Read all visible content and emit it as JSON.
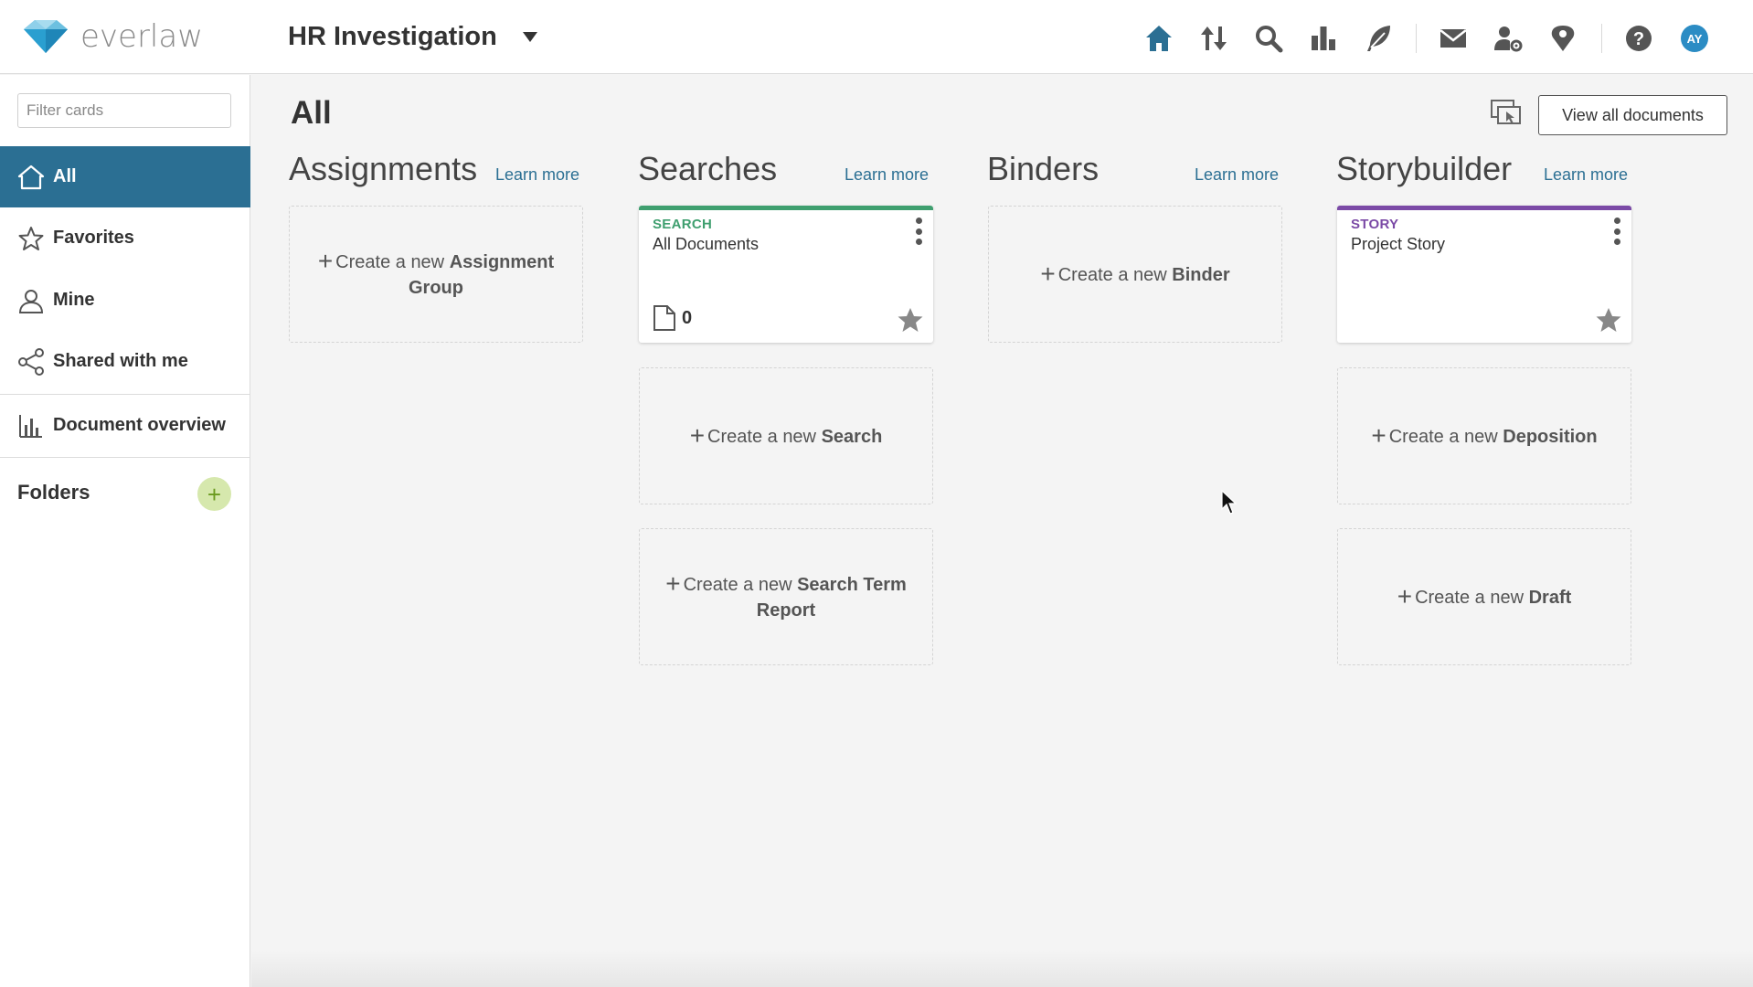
{
  "app": {
    "logo_text": "everlaw",
    "project_name": "HR Investigation"
  },
  "nav_icons": [
    "home-icon",
    "upload-download-icon",
    "search-icon",
    "analytics-icon",
    "feather-icon",
    "mail-icon",
    "user-settings-icon",
    "map-pin-icon",
    "help-icon",
    "avatar"
  ],
  "user": {
    "initials": "AY"
  },
  "sidebar": {
    "filter_placeholder": "Filter cards",
    "items": [
      {
        "label": "All",
        "icon": "home-icon",
        "active": true
      },
      {
        "label": "Favorites",
        "icon": "star-outline-icon"
      },
      {
        "label": "Mine",
        "icon": "person-icon"
      },
      {
        "label": "Shared with me",
        "icon": "share-icon"
      },
      {
        "label": "Document overview",
        "icon": "bar-chart-icon"
      }
    ],
    "folders_label": "Folders",
    "folders_add": "+"
  },
  "main": {
    "title": "All",
    "view_all_label": "View all documents",
    "columns": [
      {
        "title": "Assignments",
        "learn_more": "Learn more"
      },
      {
        "title": "Searches",
        "learn_more": "Learn more"
      },
      {
        "title": "Binders",
        "learn_more": "Learn more"
      },
      {
        "title": "Storybuilder",
        "learn_more": "Learn more"
      }
    ],
    "cards": {
      "search_card": {
        "type": "SEARCH",
        "name": "All Documents",
        "doc_count": "0"
      },
      "story_card": {
        "type": "STORY",
        "name": "Project Story"
      }
    },
    "create": {
      "prefix": "Create a new",
      "assignment": "Assignment Group",
      "search": "Search",
      "search_term_report": "Search Term Report",
      "binder": "Binder",
      "deposition": "Deposition",
      "draft": "Draft"
    }
  },
  "colors": {
    "brand_blue": "#2b6f93",
    "search_accent": "#3f9f6f",
    "story_accent": "#7b4aa6",
    "folders_add_bg": "#d6e8ad"
  }
}
